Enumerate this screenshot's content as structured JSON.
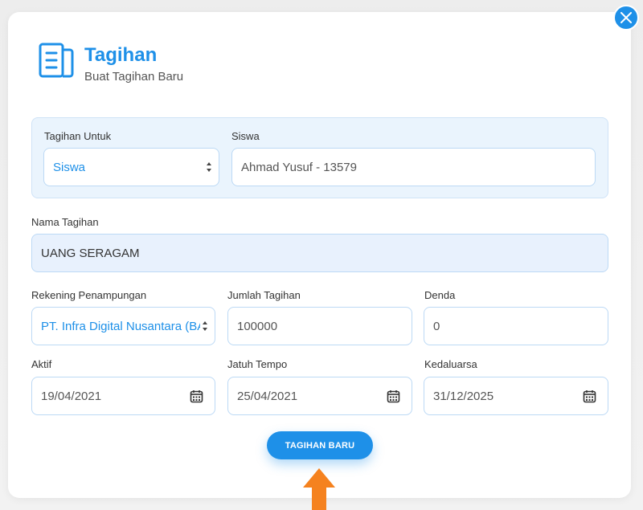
{
  "header": {
    "title": "Tagihan",
    "subtitle": "Buat Tagihan Baru"
  },
  "form": {
    "tagihan_untuk": {
      "label": "Tagihan Untuk",
      "value": "Siswa"
    },
    "siswa": {
      "label": "Siswa",
      "value": "Ahmad Yusuf - 13579"
    },
    "nama_tagihan": {
      "label": "Nama Tagihan",
      "value": "UANG SERAGAM"
    },
    "rekening": {
      "label": "Rekening Penampungan",
      "value": "PT. Infra Digital Nusantara (BA"
    },
    "jumlah": {
      "label": "Jumlah Tagihan",
      "value": "100000"
    },
    "denda": {
      "label": "Denda",
      "value": "0"
    },
    "aktif": {
      "label": "Aktif",
      "value": "19/04/2021"
    },
    "jatuh_tempo": {
      "label": "Jatuh Tempo",
      "value": "25/04/2021"
    },
    "kedaluarsa": {
      "label": "Kedaluarsa",
      "value": "31/12/2025"
    }
  },
  "actions": {
    "submit_label": "TAGIHAN BARU"
  },
  "icons": {
    "close": "close-icon",
    "header": "document-icon",
    "calendar": "calendar-icon",
    "pointer": "arrow-up-icon"
  },
  "colors": {
    "accent": "#1e90e8",
    "pointer": "#f5821f"
  }
}
